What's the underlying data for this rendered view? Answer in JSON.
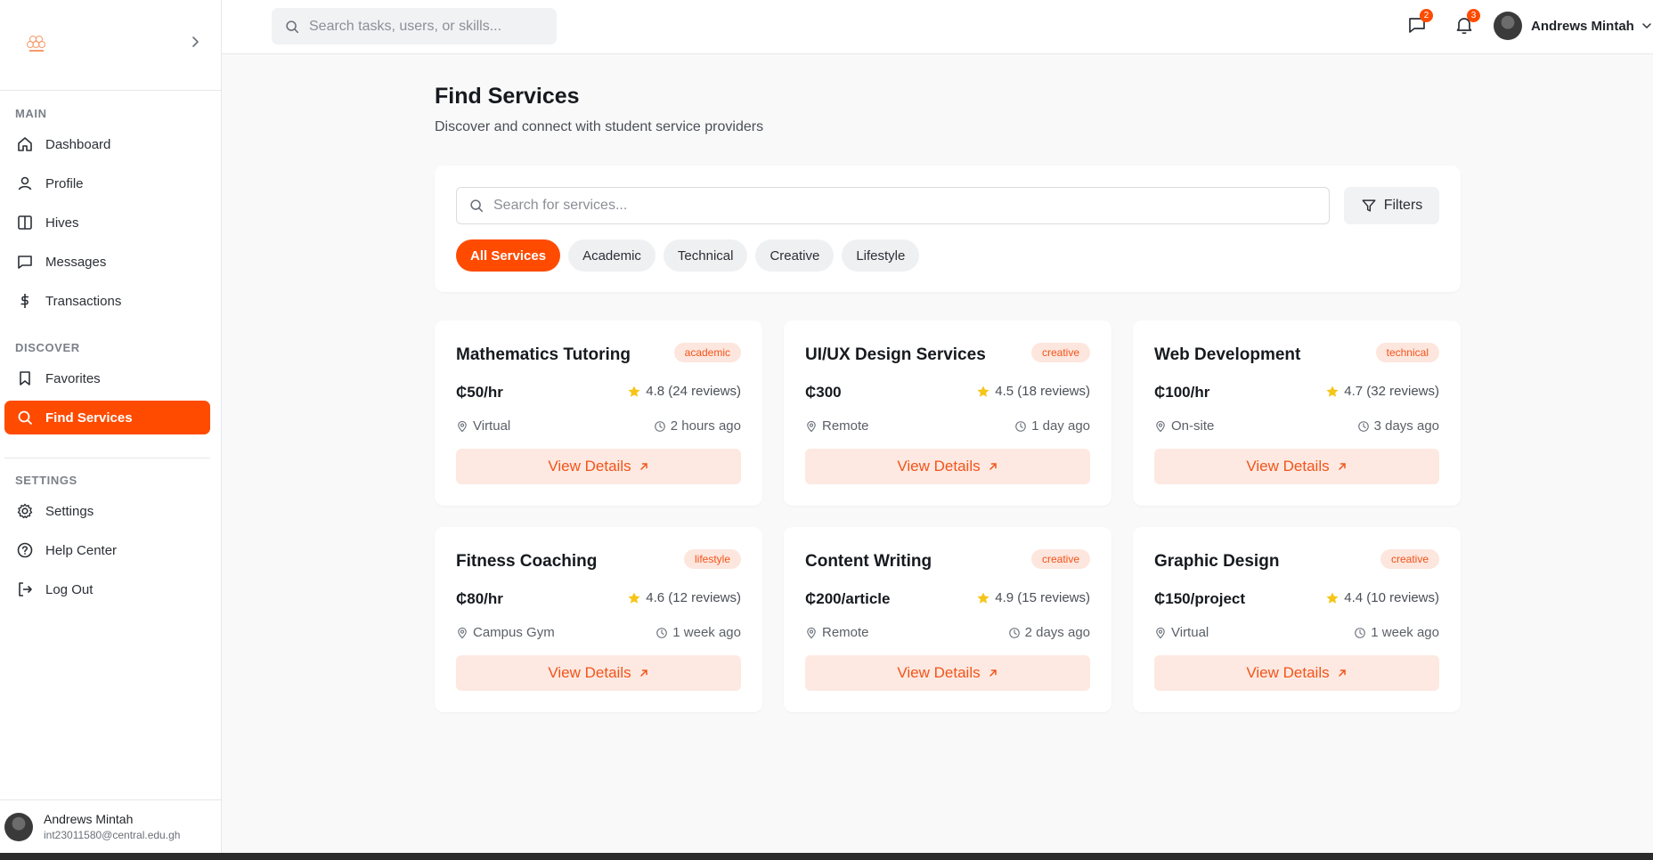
{
  "header": {
    "search_placeholder": "Search tasks, users, or skills...",
    "messages_badge": "2",
    "notifications_badge": "3",
    "user_name": "Andrews Mintah"
  },
  "sidebar": {
    "sections": [
      {
        "title": "MAIN",
        "items": [
          {
            "label": "Dashboard",
            "icon": "home-icon"
          },
          {
            "label": "Profile",
            "icon": "user-icon"
          },
          {
            "label": "Hives",
            "icon": "book-icon"
          },
          {
            "label": "Messages",
            "icon": "message-icon"
          },
          {
            "label": "Transactions",
            "icon": "dollar-icon"
          }
        ]
      },
      {
        "title": "DISCOVER",
        "items": [
          {
            "label": "Favorites",
            "icon": "bookmark-icon"
          },
          {
            "label": "Find Services",
            "icon": "search-icon",
            "active": true
          }
        ]
      },
      {
        "title": "SETTINGS",
        "items": [
          {
            "label": "Settings",
            "icon": "gear-icon"
          },
          {
            "label": "Help Center",
            "icon": "help-icon"
          },
          {
            "label": "Log Out",
            "icon": "logout-icon"
          }
        ]
      }
    ],
    "user": {
      "name": "Andrews Mintah",
      "email": "int23011580@central.edu.gh"
    }
  },
  "main": {
    "title": "Find Services",
    "subtitle": "Discover and connect with student service providers",
    "search_placeholder": "Search for services...",
    "filters_label": "Filters",
    "categories": [
      "All Services",
      "Academic",
      "Technical",
      "Creative",
      "Lifestyle"
    ],
    "active_category": "All Services",
    "view_label": "View Details",
    "services": [
      {
        "title": "Mathematics Tutoring",
        "tag": "academic",
        "price": "₵50/hr",
        "rating": "4.8 (24 reviews)",
        "location": "Virtual",
        "posted": "2 hours ago"
      },
      {
        "title": "UI/UX Design Services",
        "tag": "creative",
        "price": "₵300",
        "rating": "4.5 (18 reviews)",
        "location": "Remote",
        "posted": "1 day ago"
      },
      {
        "title": "Web Development",
        "tag": "technical",
        "price": "₵100/hr",
        "rating": "4.7 (32 reviews)",
        "location": "On-site",
        "posted": "3 days ago"
      },
      {
        "title": "Fitness Coaching",
        "tag": "lifestyle",
        "price": "₵80/hr",
        "rating": "4.6 (12 reviews)",
        "location": "Campus Gym",
        "posted": "1 week ago"
      },
      {
        "title": "Content Writing",
        "tag": "creative",
        "price": "₵200/article",
        "rating": "4.9 (15 reviews)",
        "location": "Remote",
        "posted": "2 days ago"
      },
      {
        "title": "Graphic Design",
        "tag": "creative",
        "price": "₵150/project",
        "rating": "4.4 (10 reviews)",
        "location": "Virtual",
        "posted": "1 week ago"
      }
    ]
  },
  "colors": {
    "accent": "#fe4b00",
    "tag_bg": "#fde6dd",
    "tag_text": "#f2541b",
    "star": "#f5c518"
  }
}
